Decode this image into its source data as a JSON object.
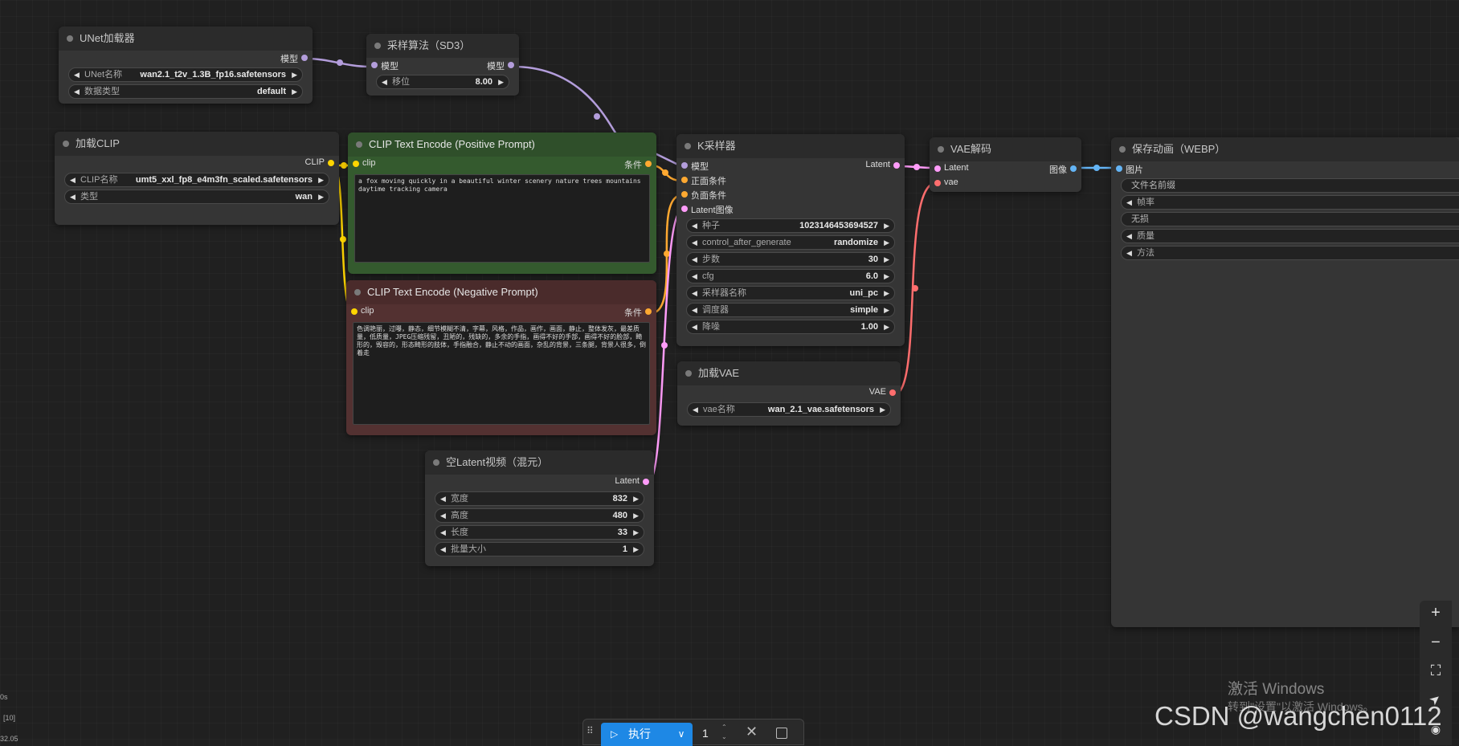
{
  "nodes": {
    "unet": {
      "title": "UNet加载器",
      "out": "模型",
      "widgets": [
        {
          "name": "UNet名称",
          "value": "wan2.1_t2v_1.3B_fp16.safetensors"
        },
        {
          "name": "数据类型",
          "value": "default"
        }
      ]
    },
    "sampling": {
      "title": "采样算法（SD3）",
      "in": "模型",
      "out": "模型",
      "widgets": [
        {
          "name": "移位",
          "value": "8.00"
        }
      ]
    },
    "clip_loader": {
      "title": "加载CLIP",
      "out": "CLIP",
      "widgets": [
        {
          "name": "CLIP名称",
          "value": "umt5_xxl_fp8_e4m3fn_scaled.safetensors"
        },
        {
          "name": "类型",
          "value": "wan"
        }
      ]
    },
    "pos": {
      "title": "CLIP Text Encode (Positive Prompt)",
      "in": "clip",
      "out": "条件",
      "text": "a fox moving quickly in a beautiful winter scenery nature trees mountains daytime tracking camera"
    },
    "neg": {
      "title": "CLIP Text Encode (Negative Prompt)",
      "in": "clip",
      "out": "条件",
      "text": "色调艳丽，过曝，静态，细节模糊不清，字幕，风格，作品，画作，画面，静止，整体发灰，最差质量，低质量，JPEG压缩残留，丑陋的，残缺的，多余的手指，画得不好的手部，画得不好的脸部，畸形的，毁容的，形态畸形的肢体，手指融合，静止不动的画面，杂乱的背景，三条腿，背景人很多，倒着走"
    },
    "ksampler": {
      "title": "K采样器",
      "inputs": [
        "模型",
        "正面条件",
        "负面条件",
        "Latent图像"
      ],
      "out": "Latent",
      "widgets": [
        {
          "name": "种子",
          "value": "1023146453694527"
        },
        {
          "name": "control_after_generate",
          "value": "randomize"
        },
        {
          "name": "步数",
          "value": "30"
        },
        {
          "name": "cfg",
          "value": "6.0"
        },
        {
          "name": "采样器名称",
          "value": "uni_pc"
        },
        {
          "name": "调度器",
          "value": "simple"
        },
        {
          "name": "降噪",
          "value": "1.00"
        }
      ]
    },
    "vae_loader": {
      "title": "加载VAE",
      "out": "VAE",
      "widgets": [
        {
          "name": "vae名称",
          "value": "wan_2.1_vae.safetensors"
        }
      ]
    },
    "latent_video": {
      "title": "空Latent视频（混元）",
      "out": "Latent",
      "widgets": [
        {
          "name": "宽度",
          "value": "832"
        },
        {
          "name": "高度",
          "value": "480"
        },
        {
          "name": "长度",
          "value": "33"
        },
        {
          "name": "批量大小",
          "value": "1"
        }
      ]
    },
    "vae_decode": {
      "title": "VAE解码",
      "inputs": [
        "Latent",
        "vae"
      ],
      "out": "图像"
    },
    "save": {
      "title": "保存动画（WEBP）",
      "in": "图片",
      "widgets": [
        {
          "name": "文件名前缀"
        },
        {
          "name": "帧率"
        },
        {
          "name": "无损"
        },
        {
          "name": "质量"
        },
        {
          "name": "方法"
        }
      ]
    }
  },
  "toolbar": {
    "run_label": "执行",
    "batch_count": "1"
  },
  "zoom": {
    "plus": "+",
    "minus": "−",
    "fit": "⛶",
    "send": "➤",
    "eye": "◉"
  },
  "status": {
    "line1": "0s",
    "line2": "[10]",
    "line3": "32.05"
  },
  "watermarks": {
    "activate_title": "激活 Windows",
    "activate_sub": "转到\"设置\"以激活 Windows。",
    "csdn": "CSDN @wangchen0112"
  },
  "colors": {
    "model": "#b39ddb",
    "clip": "#ffd500",
    "conditioning": "#ffa931",
    "latent": "#ff9cf9",
    "vae": "#ff6e6e",
    "image": "#64b5f6",
    "run_button": "#1e88e5"
  }
}
